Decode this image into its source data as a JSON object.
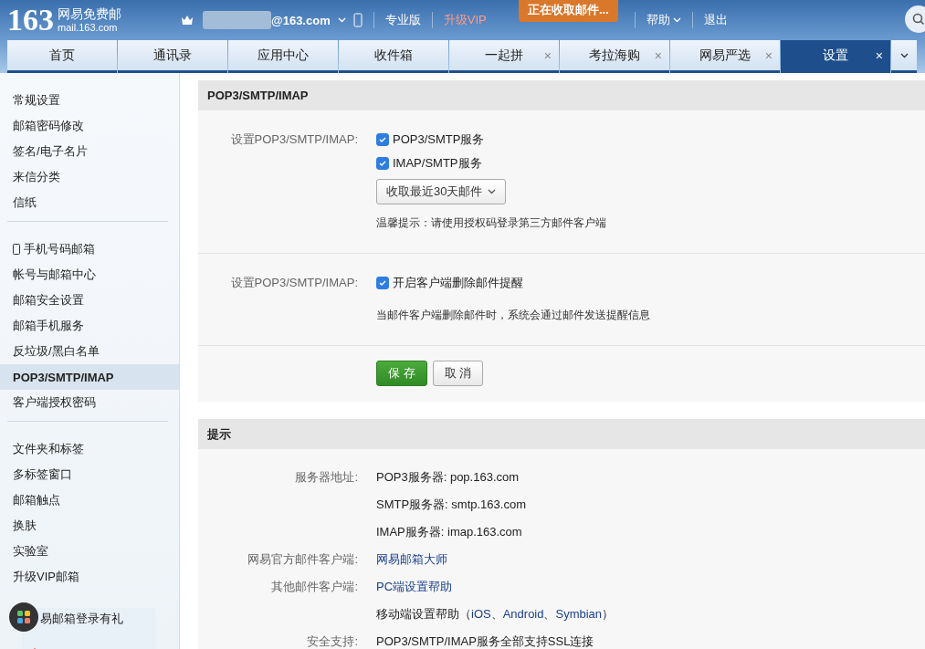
{
  "brand": {
    "logo": "163",
    "name": "网易免费邮",
    "domain": "mail.163.com"
  },
  "account": {
    "email_suffix": "@163.com"
  },
  "top_links": [
    {
      "label": "专业版",
      "kind": "plain"
    },
    {
      "label": "升级VIP",
      "kind": "vip"
    },
    {
      "label": "帮助",
      "kind": "menu"
    },
    {
      "label": "退出",
      "kind": "plain"
    }
  ],
  "toast": "正在收取邮件...",
  "tabs": [
    {
      "label": "首页",
      "selected": false
    },
    {
      "label": "通讯录",
      "selected": false
    },
    {
      "label": "应用中心",
      "selected": false
    },
    {
      "label": "收件箱",
      "selected": false
    },
    {
      "label": "一起拼",
      "close": "×",
      "selected": false
    },
    {
      "label": "考拉海购",
      "close": "×",
      "selected": false
    },
    {
      "label": "网易严选",
      "close": "×",
      "selected": false
    },
    {
      "label": "设置",
      "close": "×",
      "selected": true
    }
  ],
  "sidebar": {
    "groups": [
      [
        {
          "label": "常规设置",
          "selected": false
        },
        {
          "label": "邮箱密码修改",
          "selected": false
        },
        {
          "label": "签名/电子名片",
          "selected": false
        },
        {
          "label": "来信分类",
          "selected": false
        },
        {
          "label": "信纸",
          "selected": false
        }
      ],
      [
        {
          "label": "手机号码邮箱",
          "selected": false,
          "kind": "phone"
        },
        {
          "label": "帐号与邮箱中心",
          "selected": false
        },
        {
          "label": "邮箱安全设置",
          "selected": false
        },
        {
          "label": "邮箱手机服务",
          "selected": false
        },
        {
          "label": "反垃圾/黑白名单",
          "selected": false
        },
        {
          "label": "POP3/SMTP/IMAP",
          "selected": true
        },
        {
          "label": "客户端授权密码",
          "selected": false
        }
      ],
      [
        {
          "label": "文件夹和标签",
          "selected": false
        },
        {
          "label": "多标签窗口",
          "selected": false
        },
        {
          "label": "邮箱触点",
          "selected": false
        },
        {
          "label": "换肤",
          "selected": false
        },
        {
          "label": "实验室",
          "selected": false
        },
        {
          "label": "升级VIP邮箱",
          "selected": false
        }
      ]
    ],
    "promo": "易邮箱登录有礼"
  },
  "settings": {
    "title": "POP3/SMTP/IMAP",
    "groups": [
      {
        "label": "设置POP3/SMTP/IMAP:",
        "options": [
          {
            "label": "POP3/SMTP服务",
            "checked": true
          },
          {
            "label": "IMAP/SMTP服务",
            "checked": true
          }
        ],
        "select": "收取最近30天邮件",
        "note": "温馨提示：请使用授权码登录第三方邮件客户端"
      },
      {
        "label": "设置POP3/SMTP/IMAP:",
        "options": [
          {
            "label": "开启客户端删除邮件提醒",
            "checked": true
          }
        ],
        "note": "当邮件客户端删除邮件时，系统会通过邮件发送提醒信息"
      }
    ],
    "buttons": [
      {
        "label": "保 存",
        "kind": "primary"
      },
      {
        "label": "取 消",
        "kind": "secondary"
      }
    ]
  },
  "tips": {
    "title": "提示",
    "rows": [
      {
        "label": "服务器地址:",
        "kind": "text",
        "value": "POP3服务器: pop.163.com"
      },
      {
        "kind": "text",
        "value": "SMTP服务器: smtp.163.com"
      },
      {
        "kind": "text",
        "value": "IMAP服务器: imap.163.com"
      },
      {
        "label": "网易官方邮件客户端:",
        "kind": "link",
        "value": "网易邮箱大师"
      },
      {
        "label": "其他邮件客户端:",
        "kind": "link",
        "value": "PC端设置帮助"
      },
      {
        "kind": "links",
        "prefix": "移动端设置帮助（",
        "links": [
          "iOS",
          "Android",
          "Symbian"
        ],
        "separator": "、",
        "suffix": "）"
      },
      {
        "label": "安全支持:",
        "kind": "text",
        "value": "POP3/SMTP/IMAP服务全部支持SSL连接"
      }
    ]
  }
}
